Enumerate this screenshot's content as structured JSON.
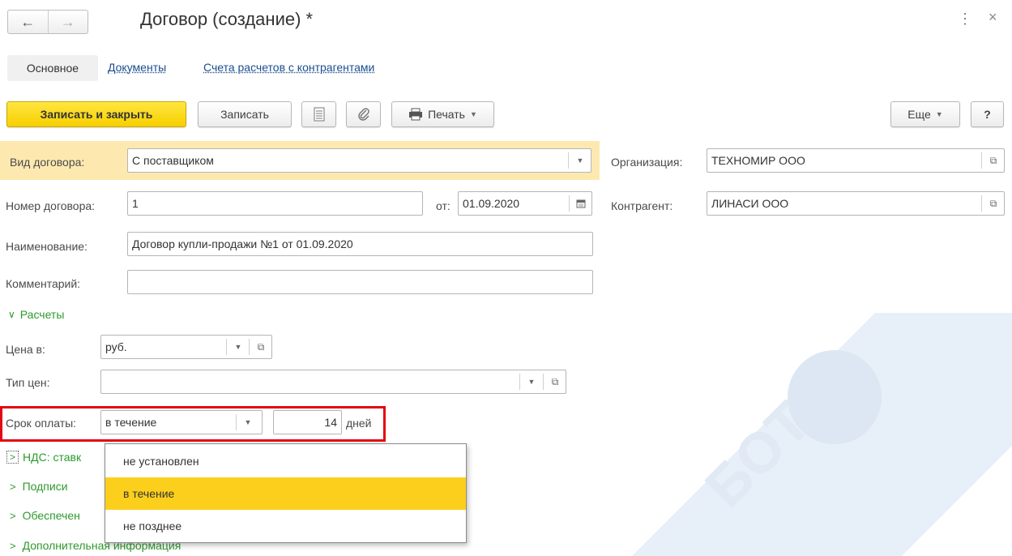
{
  "window": {
    "title": "Договор (создание) *",
    "back_icon": "←",
    "forward_icon": "→",
    "more_icon": "⋮",
    "close_icon": "×"
  },
  "tabs": [
    {
      "label": "Основное"
    },
    {
      "label": "Документы"
    },
    {
      "label": "Счета расчетов с контрагентами"
    }
  ],
  "toolbar": {
    "save_close_label": "Записать и закрыть",
    "save_label": "Записать",
    "print_label": "Печать",
    "more_label": "Еще",
    "help_label": "?"
  },
  "form": {
    "vid_label": "Вид договора:",
    "vid_value": "С поставщиком",
    "org_label": "Организация:",
    "org_value": "ТЕХНОМИР ООО",
    "nomer_label": "Номер договора:",
    "nomer_value": "1",
    "ot_label": "от:",
    "date_value": "01.09.2020",
    "kontr_label": "Контрагент:",
    "kontr_value": "ЛИНАСИ ООО",
    "name_label": "Наименование:",
    "name_value": "Договор купли-продажи №1 от 01.09.2020",
    "comment_label": "Комментарий:",
    "comment_value": ""
  },
  "raschety": {
    "header": "Расчеты",
    "cena_label": "Цена в:",
    "cena_value": "руб.",
    "tip_label": "Тип цен:",
    "tip_value": "",
    "srok_label": "Срок оплаты:",
    "srok_value": "в течение",
    "days_value": "14",
    "days_unit": "дней"
  },
  "sections": [
    {
      "label": "НДС: ставк"
    },
    {
      "label": "Подписи"
    },
    {
      "label": "Обеспечен"
    },
    {
      "label": "Дополнительная информация"
    }
  ],
  "dropdown": {
    "options": [
      "не установлен",
      "в течение",
      "не позднее"
    ],
    "selected_index": 1
  },
  "colors": {
    "accent_yellow": "#f7cf00",
    "highlight_row": "#fde9b0",
    "link": "#1a4d8f",
    "section_green": "#2c9a2c",
    "callout_red": "#e30613"
  }
}
